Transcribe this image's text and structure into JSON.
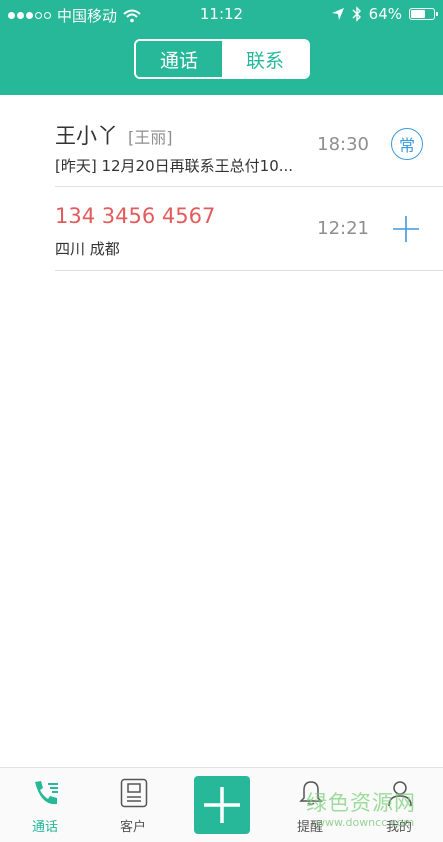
{
  "status_bar": {
    "carrier": "中国移动",
    "time": "11:12",
    "battery": "64%",
    "battery_level": 0.64
  },
  "segmented": {
    "tabs": [
      "通话",
      "联系"
    ],
    "selected": 0
  },
  "calls": [
    {
      "name": "王小丫",
      "alias": "[王丽]",
      "note": "[昨天] 12月20日再联系王总付10...",
      "time": "18:30",
      "badge": "常"
    },
    {
      "phone": "134 3456 4567",
      "location": "四川 成都",
      "time": "12:21"
    }
  ],
  "tabbar": {
    "items": [
      "通话",
      "客户",
      "提醒",
      "我的"
    ],
    "active": 0
  },
  "watermark": {
    "text": "绿色资源网",
    "url": "www.downcc.com"
  },
  "colors": {
    "brand": "#27b89a",
    "missed": "#e35b5b",
    "badge": "#3a9be0"
  }
}
